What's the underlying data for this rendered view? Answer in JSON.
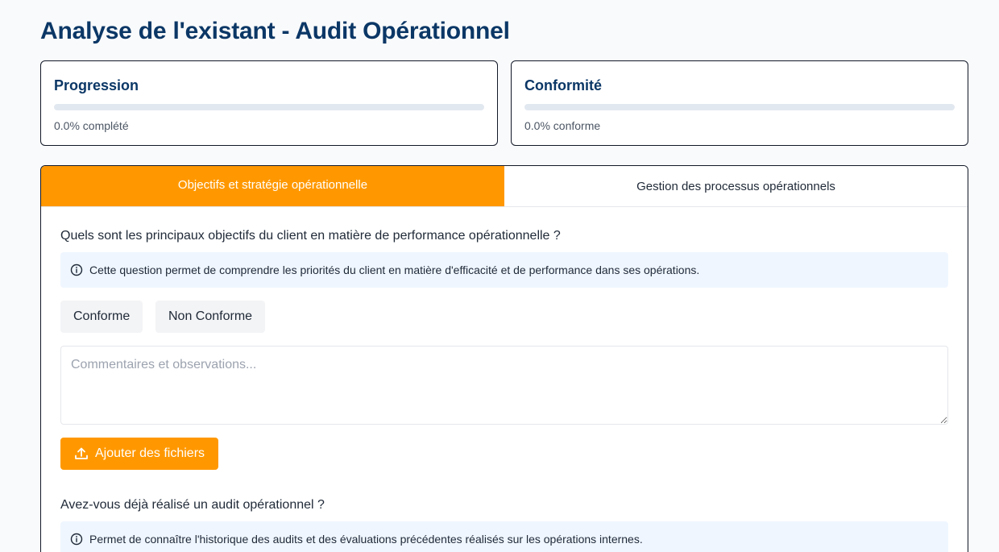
{
  "page": {
    "title": "Analyse de l'existant - Audit Opérationnel"
  },
  "progression": {
    "title": "Progression",
    "value_percent": 0,
    "text": "0.0% complété"
  },
  "conformite": {
    "title": "Conformité",
    "value_percent": 0,
    "text": "0.0% conforme"
  },
  "tabs": [
    {
      "label": "Objectifs et stratégie opérationnelle",
      "active": true
    },
    {
      "label": "Gestion des processus opérationnels",
      "active": false
    }
  ],
  "questions": [
    {
      "text": "Quels sont les principaux objectifs du client en matière de performance opérationnelle ?",
      "info": "Cette question permet de comprendre les priorités du client en matière d'efficacité et de performance dans ses opérations.",
      "conforme_label": "Conforme",
      "non_conforme_label": "Non Conforme",
      "comment_placeholder": "Commentaires et observations...",
      "comment_value": "",
      "upload_label": "Ajouter des fichiers"
    },
    {
      "text": "Avez-vous déjà réalisé un audit opérationnel ?",
      "info": "Permet de connaître l'historique des audits et des évaluations précédentes réalisés sur les opérations internes."
    }
  ],
  "icons": {
    "info": "info-icon",
    "upload": "upload-icon"
  },
  "colors": {
    "accent": "#ff9800",
    "title": "#0b3766",
    "info_bg": "#eff6ff"
  }
}
